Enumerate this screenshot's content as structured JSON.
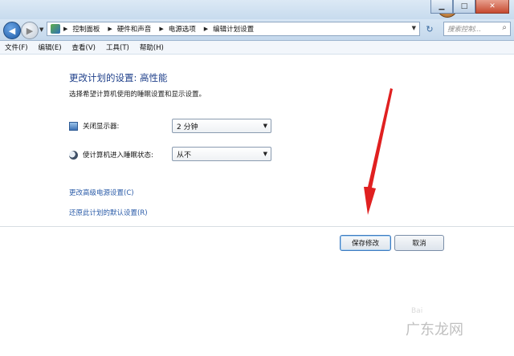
{
  "navigation": {
    "breadcrumbs": [
      "控制面板",
      "硬件和声音",
      "电源选项",
      "编辑计划设置"
    ],
    "search_placeholder": "搜索控制...",
    "back_glyph": "◀",
    "forward_glyph": "▶",
    "refresh_glyph": "↻"
  },
  "window": {
    "minimize_glyph": "▁",
    "maximize_glyph": "□",
    "close_glyph": "✕"
  },
  "menu": {
    "items": [
      "文件(F)",
      "编辑(E)",
      "查看(V)",
      "工具(T)",
      "帮助(H)"
    ]
  },
  "page": {
    "heading": "更改计划的设置: 高性能",
    "subtitle": "选择希望计算机使用的睡眠设置和显示设置。",
    "settings": [
      {
        "label": "关闭显示器:",
        "value": "2 分钟",
        "icon": "monitor-icon"
      },
      {
        "label": "使计算机进入睡眠状态:",
        "value": "从不",
        "icon": "moon-icon"
      }
    ],
    "links": [
      "更改高级电源设置(C)",
      "还原此计划的默认设置(R)"
    ],
    "save_button": "保存修改",
    "cancel_button": "取消"
  },
  "watermark": {
    "text": "广东龙网",
    "small_text": "Bai"
  },
  "colors": {
    "heading": "#1e3f8a",
    "link": "#2a5ba8",
    "arrow": "#e02020"
  }
}
